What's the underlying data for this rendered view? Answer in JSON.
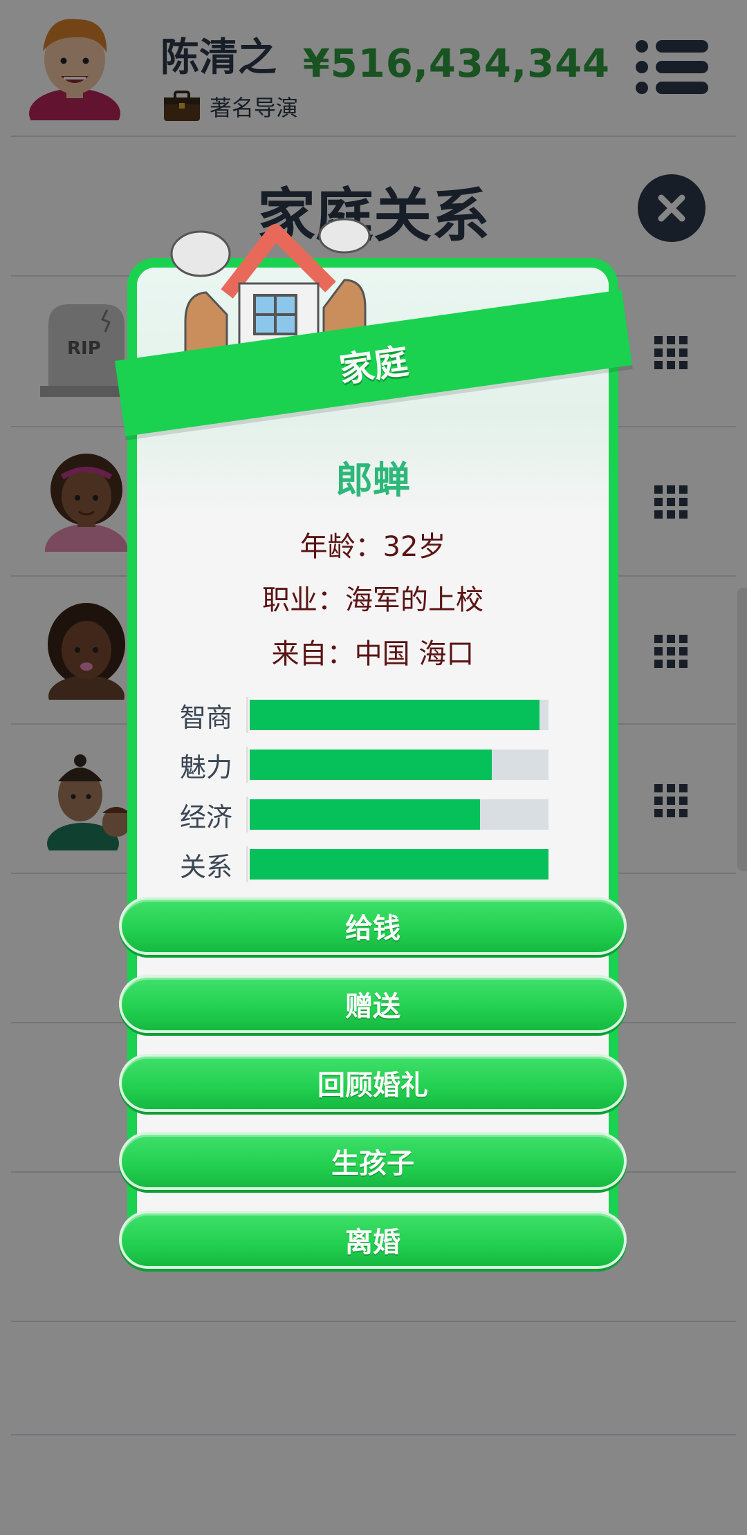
{
  "header": {
    "user_name": "陈清之",
    "job_title": "著名导演",
    "money": "¥516,434,344"
  },
  "page": {
    "title": "家庭关系"
  },
  "dialog": {
    "banner": "家庭",
    "person_name": "郎蝉",
    "age_line": "年龄：32岁",
    "job_line": "职业：海军的上校",
    "from_line": "来自：中国 海口",
    "stats": [
      {
        "label": "智商",
        "value": 0.97
      },
      {
        "label": "魅力",
        "value": 0.81
      },
      {
        "label": "经济",
        "value": 0.77
      },
      {
        "label": "关系",
        "value": 1.0
      }
    ],
    "actions": [
      "给钱",
      "赠送",
      "回顾婚礼",
      "生孩子",
      "离婚"
    ]
  },
  "background_list": {
    "rip_label": "RIP"
  },
  "colors": {
    "accent_green": "#1ad24f",
    "bar_green": "#06c05a",
    "money_green": "#2e9e3f",
    "dark_navy": "#2c3a4a",
    "name_green": "#2db87a",
    "info_brown": "#5b1414"
  }
}
